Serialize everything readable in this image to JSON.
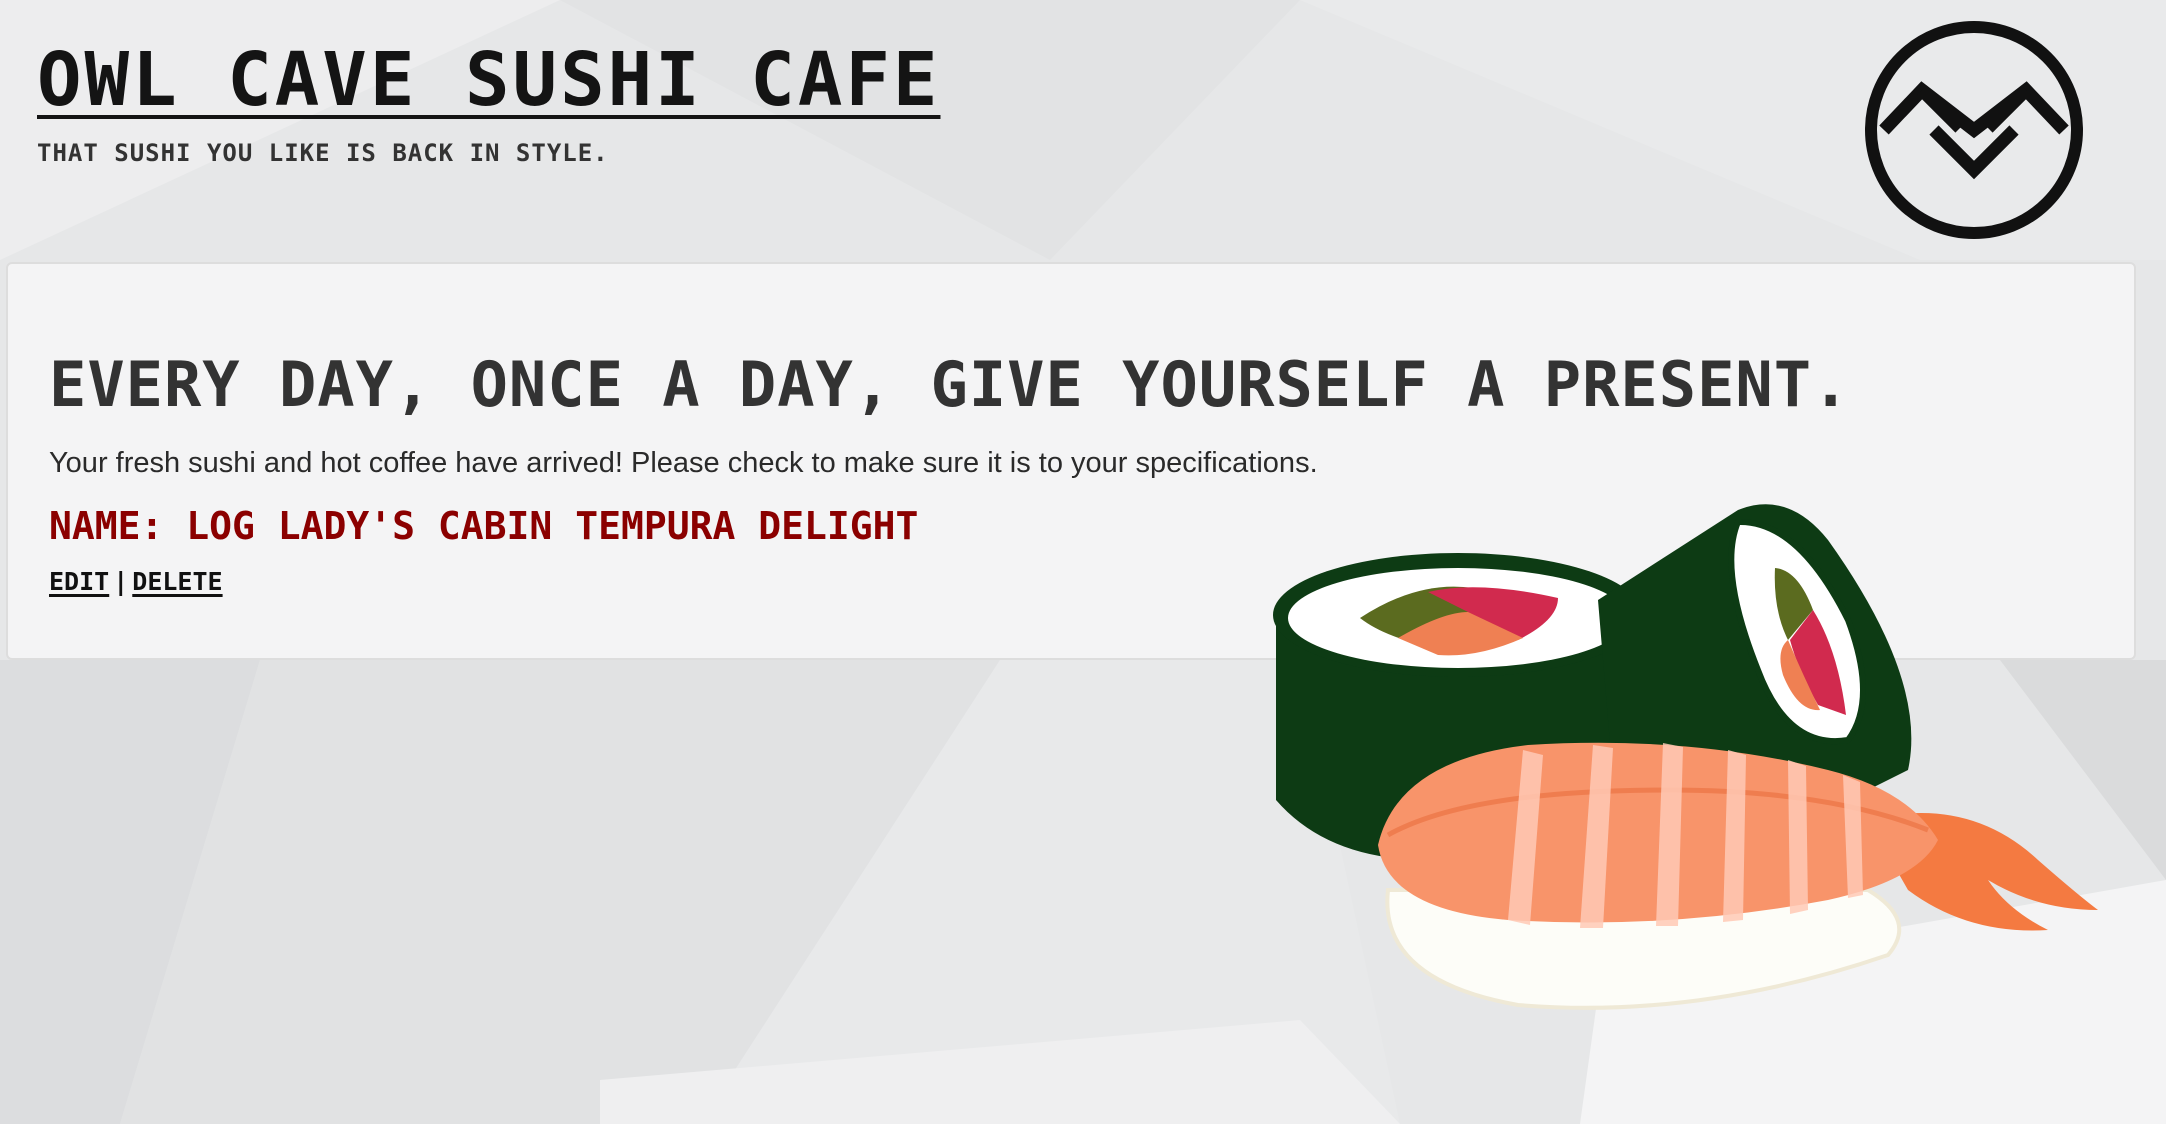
{
  "header": {
    "title": "Owl Cave Sushi Cafe",
    "tagline": "That sushi you like is back in style."
  },
  "card": {
    "heading": "Every day, once a day, give yourself a present.",
    "message": "Your fresh sushi and hot coffee have arrived! Please check to make sure it is to your specifications.",
    "order_name": "Name: Log Lady's Cabin Tempura Delight",
    "actions": {
      "edit_label": "Edit",
      "separator": "|",
      "delete_label": "Delete"
    }
  },
  "icons": {
    "logo": "owl-cave-logo-icon",
    "illustration": "sushi-illustration"
  },
  "colors": {
    "background": "#e7e8e9",
    "title": "#141414",
    "order_name": "#8b0000",
    "text": "#333333"
  }
}
